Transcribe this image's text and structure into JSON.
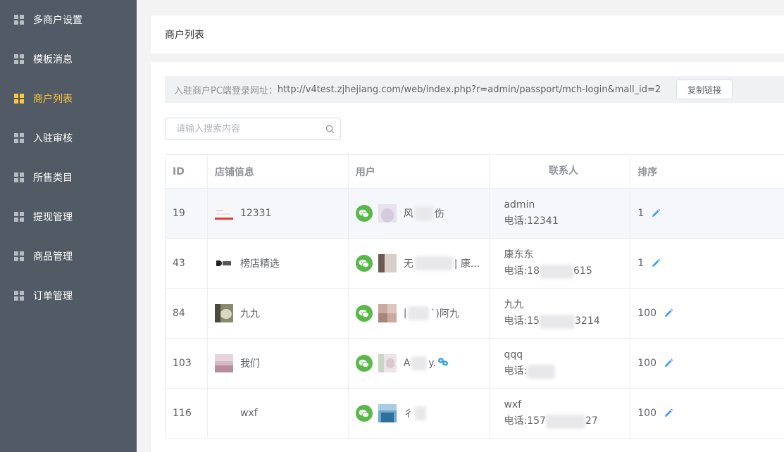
{
  "sidebar": {
    "items": [
      {
        "label": "多商户设置"
      },
      {
        "label": "模板消息"
      },
      {
        "label": "商户列表"
      },
      {
        "label": "入驻审核"
      },
      {
        "label": "所售类目"
      },
      {
        "label": "提现管理"
      },
      {
        "label": "商品管理"
      },
      {
        "label": "订单管理"
      }
    ]
  },
  "page": {
    "title": "商户列表"
  },
  "url_bar": {
    "prefix": "入驻商户PC端登录网址：",
    "url": "http://v4test.zjhejiang.com/web/index.php?r=admin/passport/mch-login&mall_id=2",
    "copy_label": "复制链接"
  },
  "search": {
    "placeholder": "请输入搜索内容"
  },
  "table": {
    "headers": {
      "id": "ID",
      "store": "店铺信息",
      "user": "用户",
      "contact": "联系人",
      "sort": "排序"
    },
    "rows": [
      {
        "id": "19",
        "store": "12331",
        "user_a": "风",
        "user_b": "伤",
        "contact_name": "admin",
        "phone_a": "电话:12341",
        "phone_b": "",
        "sort": "1"
      },
      {
        "id": "43",
        "store": "榜店精选",
        "user_a": "无",
        "user_b": "| 康...",
        "contact_name": "康东东",
        "phone_a": "电话:18",
        "phone_b": "615",
        "sort": "1"
      },
      {
        "id": "84",
        "store": "九九",
        "user_a": "|",
        "user_b": "`)阿九",
        "contact_name": "九九",
        "phone_a": "电话:15",
        "phone_b": "3214",
        "sort": "100"
      },
      {
        "id": "103",
        "store": "我们",
        "user_a": "A",
        "user_b": "y.",
        "contact_name": "qqq",
        "phone_a": "电话:",
        "phone_b": "",
        "sort": "100"
      },
      {
        "id": "116",
        "store": "wxf",
        "user_a": "彳",
        "user_b": "",
        "contact_name": "wxf",
        "phone_a": "电话:157",
        "phone_b": "27",
        "sort": "100"
      }
    ]
  },
  "colors": {
    "sidebar_bg": "#515a65",
    "active": "#ffc53d",
    "wechat_green": "#58b948",
    "edit_blue": "#409eff"
  }
}
